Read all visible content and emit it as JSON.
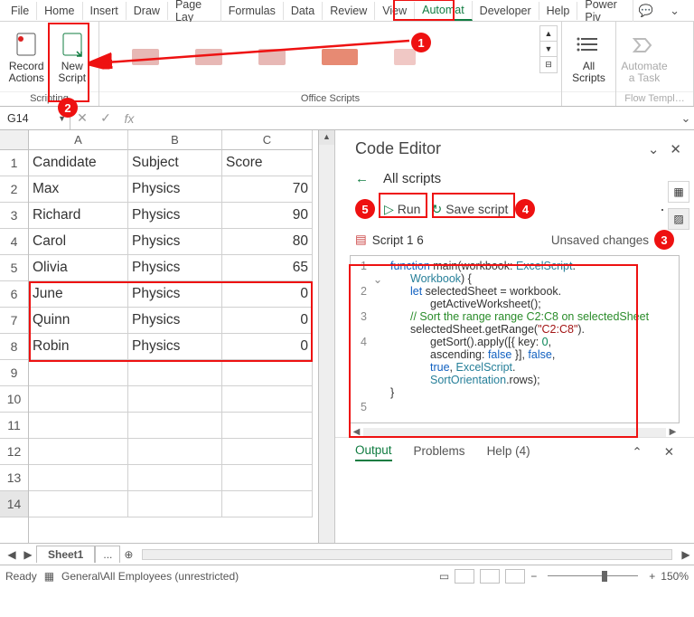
{
  "tabs": {
    "file": "File",
    "home": "Home",
    "insert": "Insert",
    "draw": "Draw",
    "pageLay": "Page Lay",
    "formulas": "Formulas",
    "data": "Data",
    "review": "Review",
    "view": "View",
    "automate": "Automat",
    "developer": "Developer",
    "help": "Help",
    "powerPi": "Power Piv"
  },
  "ribbon": {
    "recordActions": "Record\nActions",
    "newScript": "New\nScript",
    "scriptingLabel": "Scripting",
    "officeScriptsLabel": "Office Scripts",
    "allScripts": "All\nScripts",
    "automateTask": "Automate\na Task",
    "flowTemplLabel": "Flow Templ…"
  },
  "namebox": {
    "cell": "G14"
  },
  "fx": {
    "label": "fx"
  },
  "columns": [
    "A",
    "B",
    "C"
  ],
  "rows": [
    "1",
    "2",
    "3",
    "4",
    "5",
    "6",
    "7",
    "8",
    "9",
    "10",
    "11",
    "12",
    "13",
    "14"
  ],
  "data": {
    "header": [
      "Candidate",
      "Subject",
      "Score"
    ],
    "r1": [
      "Max",
      "Physics",
      "70"
    ],
    "r2": [
      "Richard",
      "Physics",
      "90"
    ],
    "r3": [
      "Carol",
      "Physics",
      "80"
    ],
    "r4": [
      "Olivia",
      "Physics",
      "65"
    ],
    "r5": [
      "June",
      "Physics",
      "0"
    ],
    "r6": [
      "Quinn",
      "Physics",
      "0"
    ],
    "r7": [
      "Robin",
      "Physics",
      "0"
    ]
  },
  "ce": {
    "title": "Code Editor",
    "allScripts": "All scripts",
    "run": "Run",
    "save": "Save script",
    "scriptName": "Script 1 6",
    "unsaved": "Unsaved changes",
    "outputTab": "Output",
    "problemsTab": "Problems",
    "helpTab": "Help (4)",
    "lineNums": [
      "1",
      "2",
      "3",
      "4",
      "5"
    ]
  },
  "code": {
    "l1a": "function",
    "l1b": " main(workbook: ",
    "l1c": "ExcelScript",
    "l1d": ".",
    "l1e": "Workbook",
    "l1f": ") {",
    "l2a": "let",
    "l2b": " selectedSheet = workbook.",
    "l2c": "getActiveWorksheet();",
    "l3": "// Sort the range range C2:C8 on selectedSheet",
    "l4a": "selectedSheet.getRange(",
    "l4b": "\"C2:C8\"",
    "l4c": ").",
    "l4d": "getSort().apply([{ key: ",
    "l4e": "0",
    "l4f": ",",
    "l4g": "ascending: ",
    "l4h": "false",
    "l4i": " }], ",
    "l4j": "false",
    "l4k": ",",
    "l4l": "true",
    "l4m": ", ",
    "l4n": "ExcelScript",
    "l4o": ".",
    "l4p": "SortOrientation",
    "l4q": ".rows);",
    "l5": "}"
  },
  "sheetTabs": {
    "s1": "Sheet1",
    "extra": "..."
  },
  "status": {
    "ready": "Ready",
    "classification": "General\\All Employees (unrestricted)",
    "zoom": "150%"
  },
  "annotations": {
    "n1": "1",
    "n2": "2",
    "n3": "3",
    "n4": "4",
    "n5": "5"
  }
}
